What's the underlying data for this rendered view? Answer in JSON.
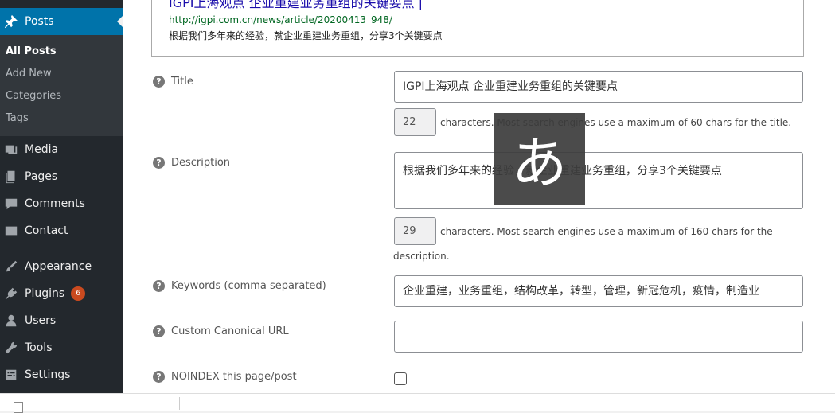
{
  "sidebar": {
    "active": {
      "label": "Posts",
      "icon": "pushpin-icon"
    },
    "submenu": [
      "All Posts",
      "Add New",
      "Categories",
      "Tags"
    ],
    "items": [
      {
        "label": "Media",
        "icon": "media-icon"
      },
      {
        "label": "Pages",
        "icon": "pages-icon"
      },
      {
        "label": "Comments",
        "icon": "comments-icon"
      },
      {
        "label": "Contact",
        "icon": "mail-icon"
      },
      {
        "label": "Appearance",
        "icon": "paintbrush-icon"
      },
      {
        "label": "Plugins",
        "icon": "plugin-icon",
        "badge": "6"
      },
      {
        "label": "Users",
        "icon": "users-icon"
      },
      {
        "label": "Tools",
        "icon": "wrench-icon"
      },
      {
        "label": "Settings",
        "icon": "settings-icon"
      }
    ]
  },
  "preview": {
    "title": "IGPI上海观点 企业重建业务重组的关键要点 |",
    "url": "http://igpi.com.cn/news/article/20200413_948/",
    "description": "根据我们多年来的经验，就企业重建业务重组，分享3个关键要点"
  },
  "fields": {
    "title": {
      "label": "Title",
      "value": "IGPI上海观点 企业重建业务重组的关键要点",
      "count": "22",
      "hint": "characters. Most search engines use a maximum of 60 chars for the title."
    },
    "description": {
      "label": "Description",
      "value": "根据我们多年来的经验，就企业重建业务重组，分享3个关键要点",
      "count": "29",
      "hint_line1": "characters. Most search engines use a maximum of 160 chars for the",
      "hint_line2": "description."
    },
    "keywords": {
      "label": "Keywords (comma separated)",
      "value": "企业重建，业务重组，结构改革，转型，管理，新冠危机，疫情，制造业"
    },
    "canonical": {
      "label": "Custom Canonical URL",
      "value": ""
    },
    "noindex": {
      "label": "NOINDEX this page/post",
      "checked": false
    }
  },
  "ime_indicator": "あ"
}
